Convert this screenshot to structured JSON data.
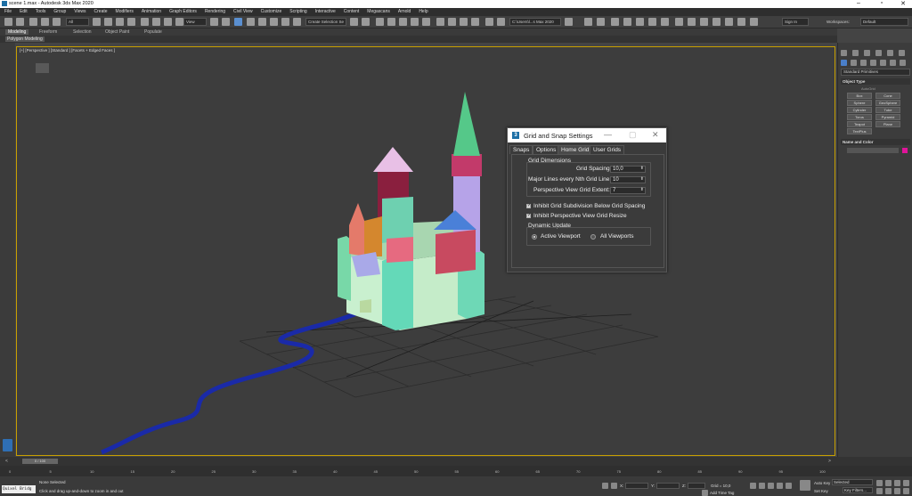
{
  "window": {
    "title": "scene 1.max - Autodesk 3ds Max 2020"
  },
  "menu": [
    "File",
    "Edit",
    "Tools",
    "Group",
    "Views",
    "Create",
    "Modifiers",
    "Animation",
    "Graph Editors",
    "Rendering",
    "Civil View",
    "Customize",
    "Scripting",
    "Interactive",
    "Content",
    "Megascans",
    "Arnold",
    "Help"
  ],
  "toolbar": {
    "filter_value": "All",
    "ref_coord": "View",
    "selection_set": "Create Selection Se",
    "project_path": "C:\\Users\\l...s Max 2020",
    "sign_in": "Sign In",
    "workspaces_label": "Workspaces:",
    "workspaces_value": "Default"
  },
  "ribbon": {
    "tabs": [
      "Modeling",
      "Freeform",
      "Selection",
      "Object Paint",
      "Populate"
    ],
    "sub_tab": "Polygon Modeling"
  },
  "viewport": {
    "label": "[+] [Perspective ] [Standard ] [Facets + Edged Faces ]",
    "colors": {
      "border": "#c8a000",
      "path": "#1a2aa8",
      "grid": "#2a2a2a"
    }
  },
  "command_panel": {
    "category": "Standard Primitives",
    "object_type_header": "Object Type",
    "autogrid": "AutoGrid",
    "primitives": [
      "Box",
      "Cone",
      "Sphere",
      "GeoSphere",
      "Cylinder",
      "Tube",
      "Torus",
      "Pyramid",
      "Teapot",
      "Plane",
      "TextPlus"
    ],
    "name_color_header": "Name and Color",
    "swatch_color": "#e0149a"
  },
  "dialog": {
    "title": "Grid and Snap Settings",
    "tabs": [
      "Snaps",
      "Options",
      "Home Grid",
      "User Grids"
    ],
    "active_tab": "Home Grid",
    "grid_dimensions": "Grid Dimensions",
    "grid_spacing_label": "Grid Spacing:",
    "grid_spacing_value": "10,0",
    "major_lines_label": "Major Lines every Nth Grid Line:",
    "major_lines_value": "10",
    "persp_extent_label": "Perspective View Grid Extent:",
    "persp_extent_value": "7",
    "inhibit_subdivision": "Inhibit Grid Subdivision Below Grid Spacing",
    "inhibit_subdivision_checked": true,
    "inhibit_resize": "Inhibit Perspective View Grid Resize",
    "inhibit_resize_checked": true,
    "dynamic_update": "Dynamic Update",
    "active_viewport": "Active Viewport",
    "all_viewports": "All Viewports",
    "selected_update": "Active Viewport"
  },
  "timeline": {
    "frame": "0 / 100",
    "ticks": [
      "0",
      "5",
      "10",
      "15",
      "20",
      "25",
      "30",
      "35",
      "40",
      "45",
      "50",
      "55",
      "60",
      "65",
      "70",
      "75",
      "80",
      "85",
      "90",
      "95",
      "100"
    ]
  },
  "status": {
    "maxscript": "Quixel Bridg",
    "selection": "None Selected",
    "prompt": "Click and drag up-and-down to zoom in and out",
    "x_label": "X:",
    "y_label": "Y:",
    "z_label": "Z:",
    "grid": "Grid = 10,0",
    "add_time_tag": "Add Time Tag",
    "auto_key": "Auto Key",
    "set_key": "Set Key",
    "selected": "Selected",
    "key_filters": "Key Filters..."
  }
}
